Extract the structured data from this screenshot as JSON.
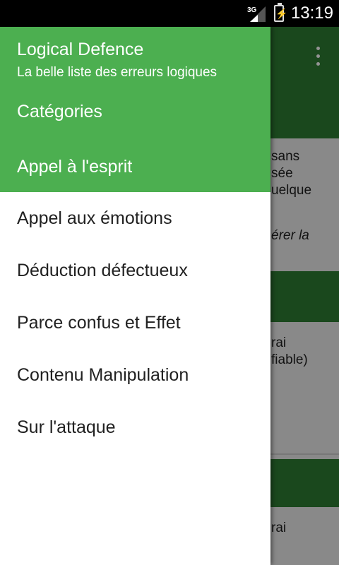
{
  "status_bar": {
    "network": "3G",
    "time": "13:19"
  },
  "drawer": {
    "app_title": "Logical Defence",
    "app_subtitle": "La belle liste des erreurs logiques",
    "section_title": "Catégories",
    "selected_item": "Appel à l'esprit",
    "items": [
      {
        "label": "Appel aux émotions"
      },
      {
        "label": "Déduction défectueux"
      },
      {
        "label": "Parce confus et Effet"
      },
      {
        "label": "Contenu Manipulation"
      },
      {
        "label": "Sur l'attaque"
      }
    ]
  },
  "background": {
    "card1_lines": [
      "sans",
      "sée",
      "uelque"
    ],
    "card1_italic": "érer la",
    "card2_lines": [
      "rai",
      "fiable)"
    ],
    "card3_lines": [
      "rai"
    ]
  },
  "colors": {
    "header": "#4caf50",
    "app_bar": "#2e7d32"
  }
}
